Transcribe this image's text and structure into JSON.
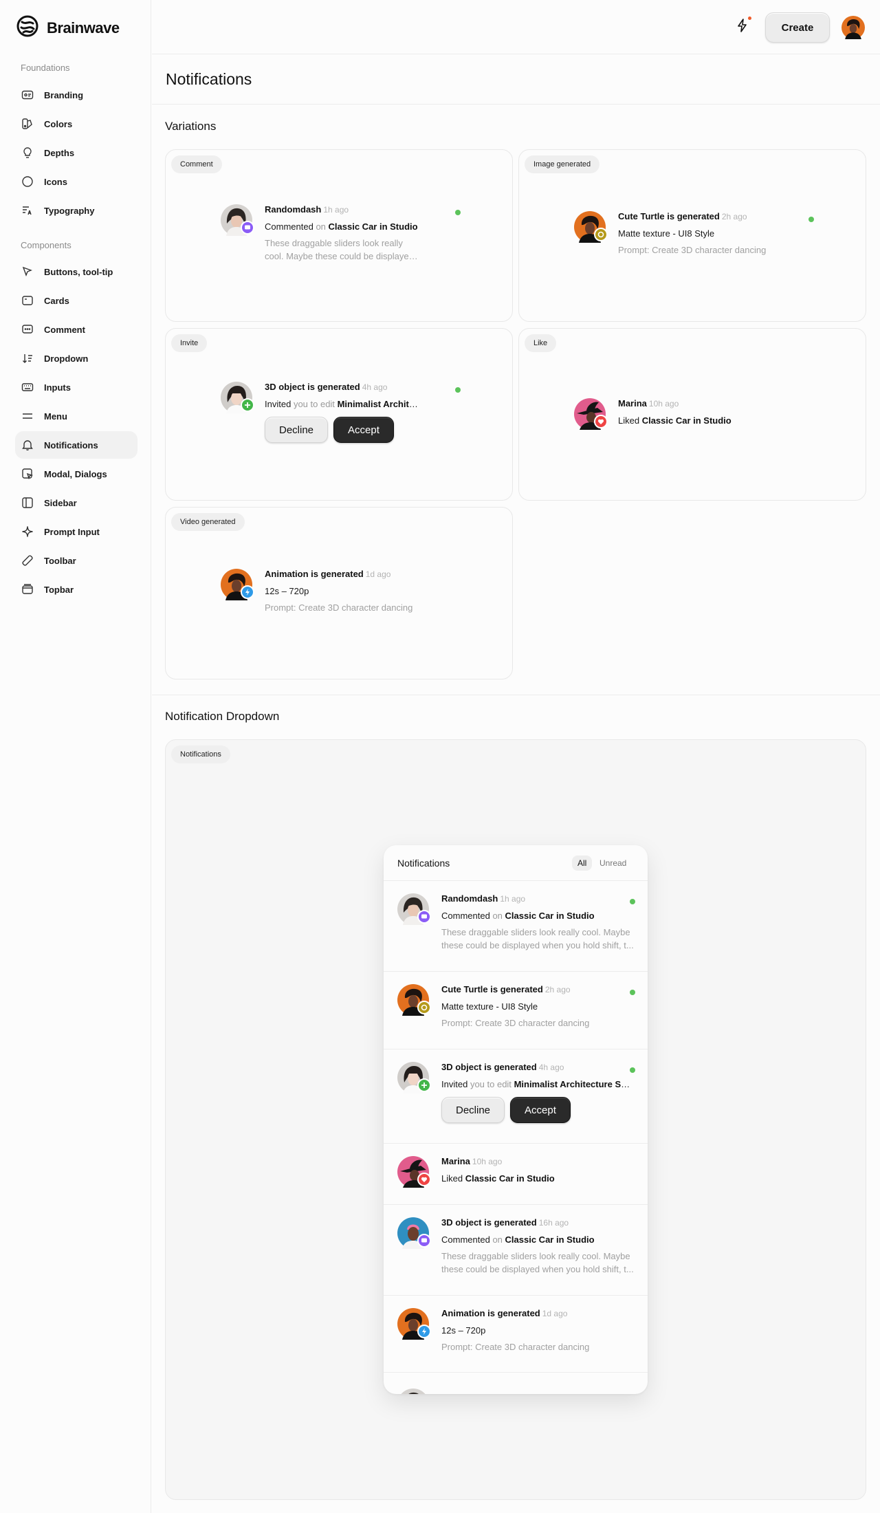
{
  "app": {
    "name": "Brainwave"
  },
  "sidebar": {
    "sections": [
      {
        "title": "Foundations",
        "items": [
          {
            "label": "Branding",
            "icon": "branding-icon"
          },
          {
            "label": "Colors",
            "icon": "palette-icon"
          },
          {
            "label": "Depths",
            "icon": "lightbulb-icon"
          },
          {
            "label": "Icons",
            "icon": "circle-icon"
          },
          {
            "label": "Typography",
            "icon": "typography-icon"
          }
        ]
      },
      {
        "title": "Components",
        "items": [
          {
            "label": "Buttons, tool-tip",
            "icon": "cursor-icon"
          },
          {
            "label": "Cards",
            "icon": "card-icon"
          },
          {
            "label": "Comment",
            "icon": "comment-icon"
          },
          {
            "label": "Dropdown",
            "icon": "sort-icon"
          },
          {
            "label": "Inputs",
            "icon": "keyboard-icon"
          },
          {
            "label": "Menu",
            "icon": "menu-icon"
          },
          {
            "label": "Notifications",
            "icon": "bell-icon",
            "active": true
          },
          {
            "label": "Modal, Dialogs",
            "icon": "modal-icon"
          },
          {
            "label": "Sidebar",
            "icon": "sidebar-icon"
          },
          {
            "label": "Prompt Input",
            "icon": "sparkle-icon"
          },
          {
            "label": "Toolbar",
            "icon": "ruler-icon"
          },
          {
            "label": "Topbar",
            "icon": "topbar-icon"
          }
        ]
      }
    ]
  },
  "topbar": {
    "create_label": "Create",
    "bolt_icon": "bolt-icon",
    "notification_dot_color": "#ef5a2a"
  },
  "page": {
    "title": "Notifications"
  },
  "variations": {
    "title": "Variations",
    "cards": [
      {
        "chip": "Comment",
        "author": "Randomdash",
        "time": "1h ago",
        "line2_action": "Commented",
        "line2_connector": "on",
        "line2_target": "Classic Car in Studio",
        "line3": "These draggable sliders look really cool. Maybe these could be displayed when you hold shift, t...",
        "unread": true,
        "badge": "comment-badge-icon"
      },
      {
        "chip": "Image generated",
        "author": "Cute Turtle is generated",
        "time": "2h ago",
        "line2": "Matte texture - UI8 Style",
        "line3": "Prompt: Create 3D character dancing",
        "unread": true,
        "badge": "image-badge-icon"
      },
      {
        "chip": "Invite",
        "author": "3D object is generated",
        "time": "4h ago",
        "line2_action": "Invited",
        "line2_connector": "you to edit",
        "line2_target": "Minimalist Architecture Sce...",
        "decline_label": "Decline",
        "accept_label": "Accept",
        "unread": true,
        "badge": "plus-badge-icon"
      },
      {
        "chip": "Like",
        "author": "Marina",
        "time": "10h ago",
        "line2_action": "Liked",
        "line2_target": "Classic Car in Studio",
        "unread": false,
        "badge": "heart-badge-icon"
      },
      {
        "chip": "Video generated",
        "author": "Animation is generated",
        "time": "1d ago",
        "line2": "12s – 720p",
        "line3": "Prompt: Create 3D character dancing",
        "unread": false,
        "badge": "bolt-badge-icon"
      }
    ]
  },
  "dropdown_section": {
    "title": "Notification Dropdown",
    "chip": "Notifications",
    "panel": {
      "title": "Notifications",
      "tabs": [
        {
          "label": "All",
          "active": true
        },
        {
          "label": "Unread",
          "active": false
        }
      ],
      "items": [
        {
          "author": "Randomdash",
          "time": "1h ago",
          "line2_action": "Commented",
          "line2_connector": "on",
          "line2_target": "Classic Car in Studio",
          "line3": "These draggable sliders look really cool. Maybe these could be displayed when you hold shift, t...",
          "unread": true
        },
        {
          "author": "Cute Turtle is generated",
          "time": "2h ago",
          "line2": "Matte texture - UI8 Style",
          "line3": "Prompt: Create 3D character dancing",
          "unread": true
        },
        {
          "author": "3D object is generated",
          "time": "4h ago",
          "line2_action": "Invited",
          "line2_connector": "you to edit",
          "line2_target": "Minimalist Architecture Sce...",
          "decline_label": "Decline",
          "accept_label": "Accept",
          "unread": true
        },
        {
          "author": "Marina",
          "time": "10h ago",
          "line2_action": "Liked",
          "line2_target": "Classic Car in Studio",
          "unread": false
        },
        {
          "author": "3D object is generated",
          "time": "16h ago",
          "line2_action": "Commented",
          "line2_connector": "on",
          "line2_target": "Classic Car in Studio",
          "line3": "These draggable sliders look really cool. Maybe these could be displayed when you hold shift, t...",
          "unread": false
        },
        {
          "author": "Animation is generated",
          "time": "1d ago",
          "line2": "12s – 720p",
          "line3": "Prompt: Create 3D character dancing",
          "unread": false
        }
      ]
    }
  },
  "colors": {
    "unread_dot": "#5cc35b",
    "accept_bg": "#2a2a2a",
    "comment_badge": "#8b5cf6",
    "image_badge": "#b59a1a",
    "plus_badge": "#43b649",
    "heart_badge": "#ef4444",
    "bolt_badge": "#2f9be8"
  }
}
